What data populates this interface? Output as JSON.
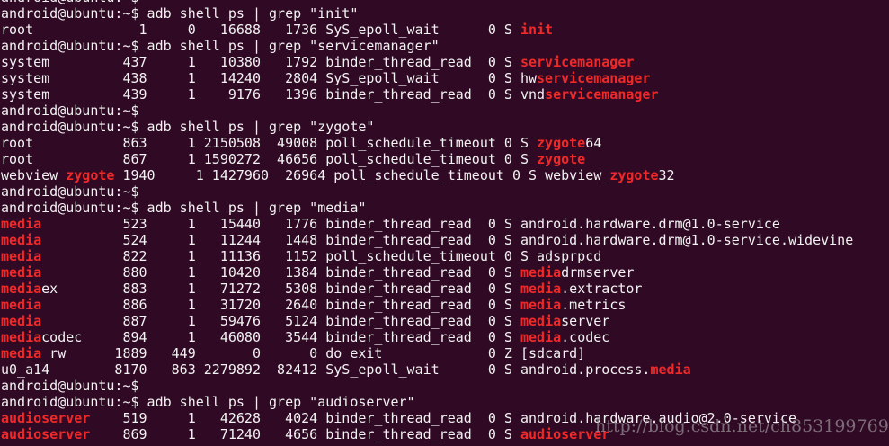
{
  "terminal": {
    "background": "#300a24",
    "text_color": "#f2f2f2",
    "highlight_color": "#ef2929",
    "lines": [
      [
        "android@ubuntu:~$ "
      ],
      [
        "android@ubuntu:~$ adb shell ps | grep \"init\""
      ],
      [
        "root             1     0   16688   1736 SyS_epoll_wait      0 S ",
        "init"
      ],
      [
        "android@ubuntu:~$ adb shell ps | grep \"servicemanager\""
      ],
      [
        "system         437     1   10380   1792 binder_thread_read  0 S ",
        "servicemanager"
      ],
      [
        "system         438     1   14240   2804 SyS_epoll_wait      0 S hw",
        "servicemanager"
      ],
      [
        "system         439     1    9176   1396 binder_thread_read  0 S vnd",
        "servicemanager"
      ],
      [
        "android@ubuntu:~$"
      ],
      [
        "android@ubuntu:~$ adb shell ps | grep \"zygote\""
      ],
      [
        "root           863     1 2150508  49008 poll_schedule_timeout 0 S ",
        "zygote",
        "64"
      ],
      [
        "root           867     1 1590272  46656 poll_schedule_timeout 0 S ",
        "zygote"
      ],
      [
        "webview_",
        "zygote",
        " 1940     1 1427960  26964 poll_schedule_timeout 0 S webview_",
        "zygote",
        "32"
      ],
      [
        "android@ubuntu:~$"
      ],
      [
        "android@ubuntu:~$ adb shell ps | grep \"media\""
      ],
      [
        "",
        "media",
        "          523     1   15440   1776 binder_thread_read  0 S android.hardware.drm@1.0-service"
      ],
      [
        "",
        "media",
        "          524     1   11244   1448 binder_thread_read  0 S android.hardware.drm@1.0-service.widevine"
      ],
      [
        "",
        "media",
        "          822     1   11136   1152 poll_schedule_timeout 0 S adsprpcd"
      ],
      [
        "",
        "media",
        "          880     1   10420   1384 binder_thread_read  0 S ",
        "media",
        "drmserver"
      ],
      [
        "",
        "media",
        "ex        883     1   71272   5308 binder_thread_read  0 S ",
        "media",
        ".extractor"
      ],
      [
        "",
        "media",
        "          886     1   31720   2640 binder_thread_read  0 S ",
        "media",
        ".metrics"
      ],
      [
        "",
        "media",
        "          887     1   59476   5124 binder_thread_read  0 S ",
        "media",
        "server"
      ],
      [
        "",
        "media",
        "codec     894     1   46080   3544 binder_thread_read  0 S ",
        "media",
        ".codec"
      ],
      [
        "",
        "media",
        "_rw      1889   449       0      0 do_exit             0 Z [sdcard]"
      ],
      [
        "u0_a14        8170   863 2279892  82412 SyS_epoll_wait      0 S android.process.",
        "media"
      ],
      [
        "android@ubuntu:~$"
      ],
      [
        "android@ubuntu:~$ adb shell ps | grep \"audioserver\""
      ],
      [
        "",
        "audioserver",
        "    519     1   42628   4024 binder_thread_read  0 S android.hardware.audio@2.0-service"
      ],
      [
        "",
        "audioserver",
        "    869     1   71240   4656 binder_thread_read  0 S ",
        "audioserver"
      ]
    ]
  },
  "watermark": "http://blog.csdn.net/ch853199769"
}
